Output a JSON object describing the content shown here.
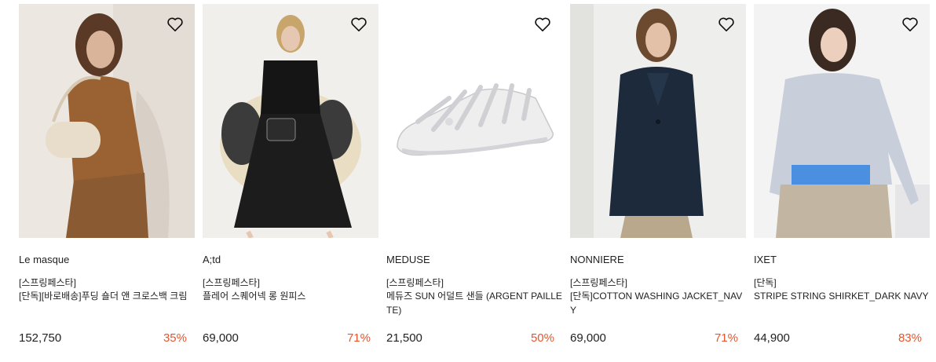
{
  "accent": "#e8542a",
  "products": [
    {
      "brand": "Le masque",
      "tag": "[스프링페스타]",
      "title": "[단독][바로배송]푸딩 숄더 앤 크로스백 크림",
      "price": "152,750",
      "discount": "35%",
      "image_icon": "model-with-shoulder-bag-photo"
    },
    {
      "brand": "A;td",
      "tag": "[스프링페스타]",
      "title": "플레어 스퀘어넥 롱 원피스",
      "price": "69,000",
      "discount": "71%",
      "image_icon": "model-in-black-dress-photo"
    },
    {
      "brand": "MEDUSE",
      "tag": "[스프링페스타]",
      "title": "메듀즈 SUN 어덜트 샌들 (ARGENT PAILLETE)",
      "price": "21,500",
      "discount": "50%",
      "image_icon": "clear-jelly-sandal-photo"
    },
    {
      "brand": "NONNIERE",
      "tag": "[스프링페스타]",
      "title": "[단독]COTTON WASHING JACKET_NAVY",
      "price": "69,000",
      "discount": "71%",
      "image_icon": "model-in-navy-jacket-photo"
    },
    {
      "brand": "IXET",
      "tag": "[단독]",
      "title": "STRIPE STRING SHIRKET_DARK NAVY",
      "price": "44,900",
      "discount": "83%",
      "image_icon": "model-in-striped-shirt-photo"
    }
  ]
}
